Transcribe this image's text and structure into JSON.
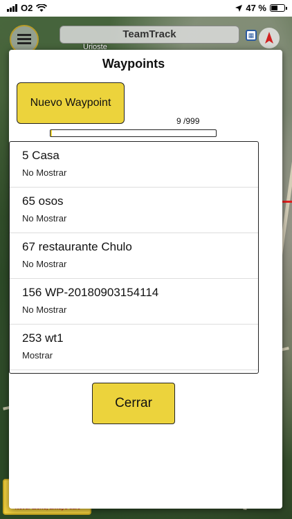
{
  "status_bar": {
    "carrier": "O2",
    "battery_text": "47 %",
    "battery_level": 0.47
  },
  "app_bar": {
    "title": "TeamTrack",
    "map_label": "Urioste"
  },
  "banner": {
    "tagline": "Never alone, always safe"
  },
  "modal": {
    "title": "Waypoints",
    "new_button_label": "Nuevo Waypoint",
    "count_text": "9 /999",
    "usage_fraction": 0.009,
    "close_button_label": "Cerrar"
  },
  "waypoints": [
    {
      "name": "5 Casa",
      "visibility": "No Mostrar"
    },
    {
      "name": "65 osos",
      "visibility": "No Mostrar"
    },
    {
      "name": "67 restaurante Chulo",
      "visibility": "No Mostrar"
    },
    {
      "name": "156 WP-20180903154114",
      "visibility": "No Mostrar"
    },
    {
      "name": "253 wt1",
      "visibility": "Mostrar"
    }
  ],
  "colors": {
    "accent": "#ecd33c",
    "compass": "#d02020"
  }
}
